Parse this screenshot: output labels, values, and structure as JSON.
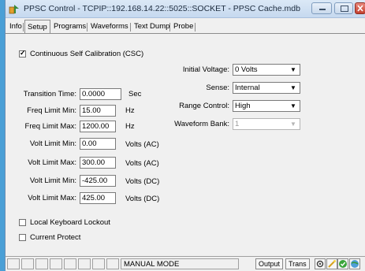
{
  "window": {
    "title": "PPSC Control - TCPIP::192.168.14.22::5025::SOCKET - PPSC Cache.mdb",
    "icons": {
      "app": "app-icon",
      "minimize": "minimize-icon",
      "maximize": "maximize-icon",
      "close": "close-icon"
    }
  },
  "tabs": [
    {
      "label": "Info"
    },
    {
      "label": "Setup",
      "selected": true
    },
    {
      "label": "Programs"
    },
    {
      "label": "Waveforms"
    },
    {
      "label": "Text Dump"
    },
    {
      "label": "Probe"
    }
  ],
  "setup": {
    "csc": {
      "label": "Continuous Self Calibration (CSC)",
      "checked": true
    },
    "fields": [
      {
        "label": "Transition Time:",
        "value": "0.0000",
        "unit": "Sec"
      },
      {
        "label": "Freq Limit Min:",
        "value": "15.00",
        "unit": "Hz"
      },
      {
        "label": "Freq Limit Max:",
        "value": "1200.00",
        "unit": "Hz"
      },
      {
        "label": "Volt Limit Min:",
        "value": "0.00",
        "unit": "Volts (AC)"
      },
      {
        "label": "Volt Limit Max:",
        "value": "300.00",
        "unit": "Volts (AC)"
      },
      {
        "label": "Volt Limit Min:",
        "value": "-425.00",
        "unit": "Volts (DC)"
      },
      {
        "label": "Volt Limit Max:",
        "value": "425.00",
        "unit": "Volts (DC)"
      }
    ],
    "selects": [
      {
        "label": "Initial Voltage:",
        "value": "0 Volts",
        "disabled": false
      },
      {
        "label": "Sense:",
        "value": "Internal",
        "disabled": false
      },
      {
        "label": "Range Control:",
        "value": "High",
        "disabled": false
      },
      {
        "label": "Waveform Bank:",
        "value": "1",
        "disabled": true
      }
    ],
    "local_keyboard_lockout": {
      "label": "Local Keyboard Lockout",
      "checked": false
    },
    "current_protect": {
      "label": "Current Protect",
      "checked": false
    }
  },
  "statusbar": {
    "mode": "MANUAL MODE",
    "output_label": "Output",
    "trans_label": "Trans",
    "icons": [
      "status-gear-icon",
      "status-wand-icon",
      "status-ok-icon",
      "status-globe-icon"
    ]
  }
}
